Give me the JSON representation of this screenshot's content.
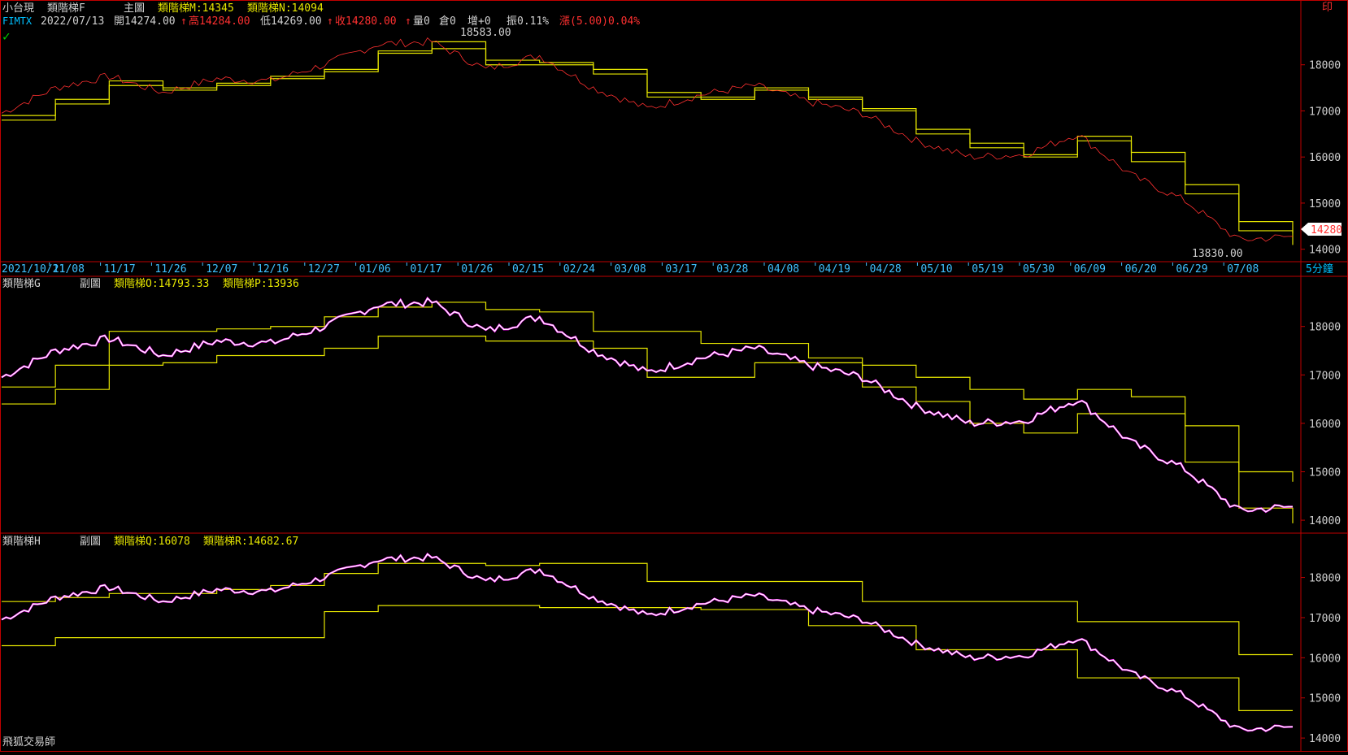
{
  "header": {
    "line1": {
      "product": "小台現",
      "indicator": "類階梯F",
      "chart_label": "主圖",
      "ind_m": "類階梯M:14345",
      "ind_n": "類階梯N:14094",
      "date": "2022/07/13",
      "open": "開14274.00",
      "high": "高14284.00",
      "low": "低14269.00",
      "close": "收14280.00",
      "volume": "量0",
      "oi": "倉0",
      "oi_change": "增+0",
      "amplitude": "振0.11%",
      "change": "漲(5.00)0.04%"
    },
    "line2": {
      "symbol": "FIMTX"
    },
    "corner_badge": "印"
  },
  "main_panel": {
    "high_label": "18583.00",
    "low_label": "13830.00",
    "last_price": "14280",
    "y_ticks": [
      "18000",
      "17000",
      "16000",
      "15000",
      "14000"
    ]
  },
  "date_axis": {
    "labels": [
      "2021/10/21",
      "11/08",
      "11/17",
      "11/26",
      "12/07",
      "12/16",
      "12/27",
      "01/06",
      "01/17",
      "01/26",
      "02/15",
      "02/24",
      "03/08",
      "03/17",
      "03/28",
      "04/08",
      "04/19",
      "04/28",
      "05/10",
      "05/19",
      "05/30",
      "06/09",
      "06/20",
      "06/29",
      "07/08"
    ],
    "interval": "5分鐘"
  },
  "sub_panel_1": {
    "name": "類階梯G",
    "chart_label": "副圖",
    "ind_o": "類階梯O:14793.33",
    "ind_p": "類階梯P:13936",
    "y_ticks": [
      "18000",
      "17000",
      "16000",
      "15000",
      "14000"
    ]
  },
  "sub_panel_2": {
    "name": "類階梯H",
    "chart_label": "副圖",
    "ind_q": "類階梯Q:16078",
    "ind_r": "類階梯R:14682.67",
    "y_ticks": [
      "18000",
      "17000",
      "16000",
      "15000",
      "14000"
    ]
  },
  "footer": {
    "brand": "飛狐交易師"
  },
  "colors": {
    "price": "#ffffff",
    "accent": "#ff00ff",
    "indicator": "#e6e600",
    "up": "#ff3030",
    "axis_text": "#40c0ff",
    "border": "#c00000"
  },
  "chart_data": {
    "type": "line",
    "x": [
      "2021/10/21",
      "11/08",
      "11/17",
      "11/26",
      "12/07",
      "12/16",
      "12/27",
      "01/06",
      "01/17",
      "01/26",
      "02/15",
      "02/24",
      "03/08",
      "03/17",
      "03/28",
      "04/08",
      "04/19",
      "04/28",
      "05/10",
      "05/19",
      "05/30",
      "06/09",
      "06/20",
      "06/29",
      "07/08"
    ],
    "price": [
      16950,
      17500,
      17750,
      17400,
      17700,
      17650,
      18000,
      18450,
      18500,
      17900,
      18200,
      17500,
      17050,
      17350,
      17550,
      17200,
      16950,
      16350,
      16000,
      16050,
      16500,
      15600,
      15050,
      14200,
      14280
    ],
    "step_main_1": [
      16900,
      17250,
      17650,
      17450,
      17600,
      17750,
      17900,
      18300,
      18500,
      18000,
      18000,
      17800,
      17300,
      17300,
      17500,
      17250,
      17000,
      16500,
      16200,
      16000,
      16450,
      15900,
      15200,
      14400,
      14345
    ],
    "step_main_2": [
      16800,
      17150,
      17550,
      17500,
      17550,
      17700,
      17850,
      18250,
      18350,
      18100,
      18050,
      17900,
      17400,
      17250,
      17450,
      17300,
      17050,
      16600,
      16300,
      16050,
      16350,
      16100,
      15400,
      14600,
      14094
    ],
    "step_g_upper": [
      16750,
      17200,
      17900,
      17900,
      17950,
      18000,
      18200,
      18400,
      18500,
      18350,
      18300,
      17900,
      17900,
      17650,
      17650,
      17350,
      17200,
      16950,
      16700,
      16500,
      16700,
      16550,
      15950,
      15000,
      14793.33
    ],
    "step_g_lower": [
      16400,
      16700,
      17200,
      17250,
      17400,
      17400,
      17550,
      17800,
      17800,
      17700,
      17700,
      17550,
      16950,
      16950,
      17250,
      17250,
      16750,
      16450,
      16000,
      15800,
      16200,
      16200,
      15200,
      14250,
      13936
    ],
    "step_h_upper": [
      17400,
      17500,
      17600,
      17600,
      17700,
      17800,
      18100,
      18350,
      18350,
      18300,
      18350,
      18350,
      17900,
      17900,
      17900,
      17900,
      17400,
      17400,
      17400,
      17400,
      16900,
      16900,
      16900,
      16078,
      16078
    ],
    "step_h_lower": [
      16300,
      16500,
      16500,
      16500,
      16500,
      16500,
      17150,
      17300,
      17300,
      17300,
      17250,
      17250,
      17250,
      17200,
      17200,
      16800,
      16800,
      16200,
      16200,
      16200,
      15500,
      15500,
      15500,
      14682.67,
      14682.67
    ],
    "ylim": [
      13800,
      18700
    ],
    "annotations": [
      "18583.00",
      "13830.00",
      "14280"
    ]
  }
}
